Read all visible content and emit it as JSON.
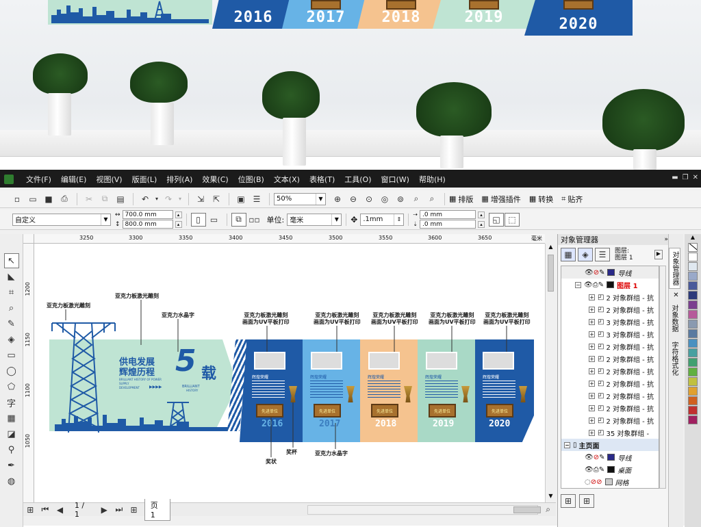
{
  "photo": {
    "years": [
      "2016",
      "2017",
      "2018",
      "2019",
      "2020"
    ],
    "colors": {
      "navy": "#1f5aa6",
      "sky": "#67b3e6",
      "peach": "#f5c38f",
      "mint": "#bfe4d3",
      "blue": "#2363b0"
    }
  },
  "menu": [
    "文件(F)",
    "编辑(E)",
    "视图(V)",
    "版面(L)",
    "排列(A)",
    "效果(C)",
    "位图(B)",
    "文本(X)",
    "表格(T)",
    "工具(O)",
    "窗口(W)",
    "帮助(H)"
  ],
  "toolbar1": {
    "zoom": "50%",
    "buttons": [
      "排版",
      "增强插件",
      "转换",
      "贴齐"
    ]
  },
  "toolbar2": {
    "preset": "自定义",
    "width": "700.0 mm",
    "height": "800.0 mm",
    "unit_label": "单位:",
    "unit_value": "毫米",
    "nudge": ".1mm",
    "dup_x": ".0 mm",
    "dup_y": ".0 mm"
  },
  "ruler": {
    "top": [
      "3250",
      "3300",
      "3350",
      "3400",
      "3450",
      "3500",
      "3550",
      "3600",
      "3650"
    ],
    "unit": "毫米",
    "left": [
      "1200",
      "1150",
      "1100",
      "1050"
    ]
  },
  "design": {
    "callouts": {
      "laser1": "亚克力板激光雕刻",
      "laser2": "亚克力板激光雕刻",
      "crystal_top": "亚克力水晶字",
      "uv_a": "亚克力板激光雕刻",
      "uv_b": "画面为UV平板打印",
      "award": "奖状",
      "cup": "奖杯",
      "crystal_bottom": "亚克力水晶字"
    },
    "title_line1": "供电发展",
    "title_line2": "辉煌历程",
    "big_five": "5",
    "big_zai": "载",
    "sub_en1": "BRILLIANT HISTORY OF POWER SUPPLY",
    "sub_en2": "DEVELOPMENT",
    "brilliant": "BRILLIANT",
    "history": "HISTORY",
    "panel_heading": "辉煌荣耀",
    "plaque": "先进单位",
    "years": [
      "2016",
      "2017",
      "2018",
      "2019",
      "2020"
    ],
    "colors": {
      "mint": "#bfe4d3",
      "navy": "#1f5aa6",
      "sky": "#67b3e6",
      "peach": "#f5c38f",
      "green": "#a9d9c6"
    }
  },
  "statusbar": {
    "page": "1 / 1",
    "tab": "页 1"
  },
  "docker": {
    "title": "对象管理器",
    "header_page": "图层:",
    "header_layer": "图层 1",
    "guides": "导线",
    "layer1": "图层 1",
    "items": [
      "2 对象群组 - 抗",
      "2 对象群组 - 抗",
      "3 对象群组 - 抗",
      "3 对象群组 - 抗",
      "2 对象群组 - 抗",
      "2 对象群组 - 抗",
      "2 对象群组 - 抗",
      "2 对象群组 - 抗",
      "2 对象群组 - 抗",
      "2 对象群组 - 抗",
      "2 对象群组 - 抗",
      "35 对象群组 -"
    ],
    "master": "主页面",
    "m_guides": "导线",
    "m_desktop": "桌面",
    "m_grid": "网格"
  },
  "sidetabs": [
    "对象管理器",
    "对象数据",
    "字符格式化"
  ],
  "palette": [
    "#ffffff",
    "#e0e8f0",
    "#9aa9c9",
    "#4a5a9a",
    "#2d3a7a",
    "#7a3f8f",
    "#b65a9a",
    "#8a9ab0",
    "#5a7aa0",
    "#4a90c0",
    "#48a0a0",
    "#40a070",
    "#60b040",
    "#c0c040",
    "#e0a030",
    "#d06020",
    "#c03030",
    "#a02060"
  ]
}
